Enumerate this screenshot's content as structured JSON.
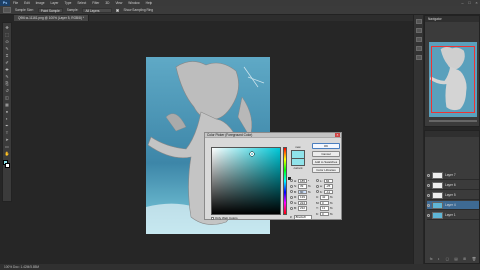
{
  "app": {
    "logo": "Ps"
  },
  "menu": [
    "File",
    "Edit",
    "Image",
    "Layer",
    "Type",
    "Select",
    "Filter",
    "3D",
    "View",
    "Window",
    "Help"
  ],
  "window_controls": {
    "minimize": "–",
    "maximize": "□",
    "close": "×"
  },
  "options_bar": {
    "sample_size_label": "Sample Size:",
    "sample_size_value": "Point Sample",
    "sample_label": "Sample:",
    "sample_value": "All Layers",
    "show_ring_label": "Show Sampling Ring"
  },
  "document_tab": "Q9I6.w-11161.png @ 100% (Layer 5, RGB/8) *",
  "toolbox": {
    "icons": [
      "move-icon",
      "marquee-icon",
      "lasso-icon",
      "quick-select-icon",
      "crop-icon",
      "eyedropper-icon",
      "healing-icon",
      "brush-icon",
      "stamp-icon",
      "history-brush-icon",
      "eraser-icon",
      "gradient-icon",
      "blur-icon",
      "dodge-icon",
      "pen-icon",
      "type-icon",
      "path-select-icon",
      "shape-icon",
      "hand-icon",
      "zoom-icon"
    ]
  },
  "toolbox_glyphs": [
    "✥",
    "⬚",
    "ʘ",
    "✎",
    "⌗",
    "✐",
    "✚",
    "✎",
    "⎘",
    "↺",
    "◫",
    "▦",
    "●",
    "◐",
    "✒",
    "T",
    "➤",
    "▭",
    "✋",
    "⌕"
  ],
  "colors": {
    "foreground": "#8be0e8",
    "background": "#ffffff",
    "canvas_bg": "#4f94b4",
    "selection": "#3e6a93"
  },
  "status_bar": "100%    Doc: 1.42M/5.85M",
  "navigator": {
    "title": "Navigator"
  },
  "layers": {
    "rows": [
      {
        "name": "Layer 7",
        "thumb": "white",
        "selected": false
      },
      {
        "name": "Layer 6",
        "thumb": "white",
        "selected": false
      },
      {
        "name": "Layer 5",
        "thumb": "white",
        "selected": false
      },
      {
        "name": "Layer 4",
        "thumb": "blue",
        "selected": true
      },
      {
        "name": "Layer 1",
        "thumb": "blue",
        "selected": false
      }
    ],
    "footer": [
      "fx",
      "◐",
      "▢",
      "▤",
      "⊞",
      "🗑"
    ]
  },
  "color_picker": {
    "title": "Color Picker (Foreground Color)",
    "close": "×",
    "new_label": "new",
    "current_label": "current",
    "buttons": {
      "ok": "OK",
      "cancel": "Cancel",
      "add_to_swatches": "Add to Swatches",
      "color_libraries": "Color Libraries"
    },
    "values": {
      "H": {
        "value": "185",
        "unit": "°"
      },
      "S": {
        "value": "39",
        "unit": "%"
      },
      "B": {
        "value": "90",
        "unit": "%"
      },
      "R": {
        "value": "139",
        "unit": ""
      },
      "G": {
        "value": "224",
        "unit": ""
      },
      "Bb": {
        "value": "232",
        "unit": ""
      }
    },
    "lab": {
      "L": {
        "value": "84"
      },
      "a": {
        "value": "-25"
      },
      "b": {
        "value": "-11"
      },
      "C": {
        "value": "42",
        "unit": "%"
      },
      "M": {
        "value": "0",
        "unit": "%"
      },
      "Y": {
        "value": "11",
        "unit": "%"
      },
      "K": {
        "value": "0",
        "unit": "%"
      }
    },
    "hex_label": "#",
    "hex": "8be0e8",
    "web_only": "Only Web Colors"
  }
}
